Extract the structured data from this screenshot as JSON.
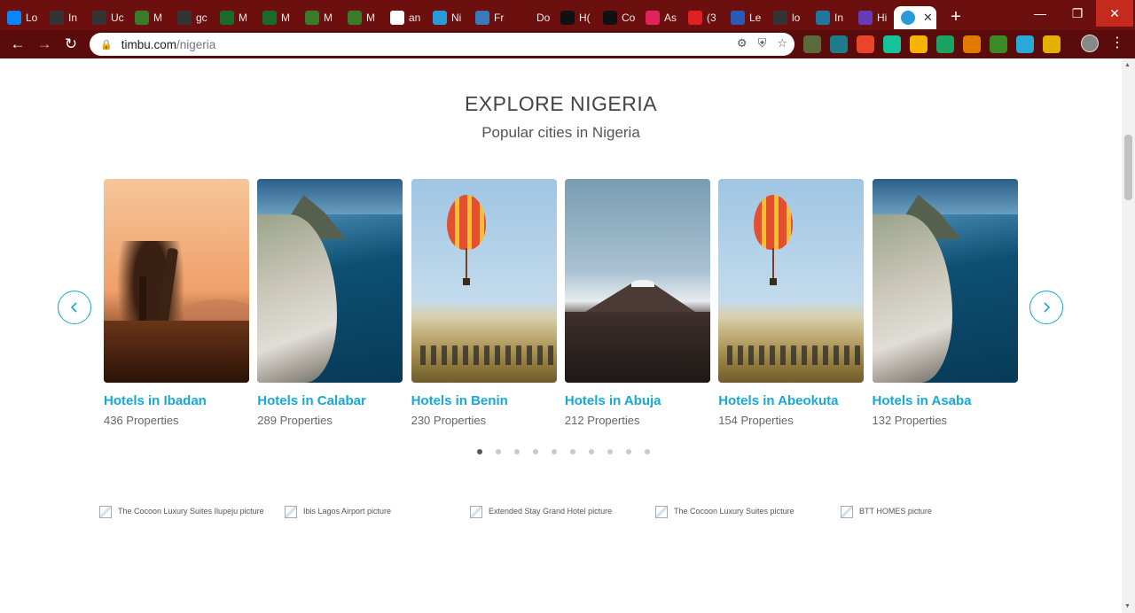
{
  "browser": {
    "tabs": [
      {
        "label": "Lo",
        "icon": "u-icon",
        "color": "#0a84ff"
      },
      {
        "label": "In",
        "icon": "globe-icon",
        "color": "#333333"
      },
      {
        "label": "Uc",
        "icon": "globe-icon",
        "color": "#333333"
      },
      {
        "label": "M",
        "icon": "plant-icon",
        "color": "#3a7a2a"
      },
      {
        "label": "gc",
        "icon": "globe-icon",
        "color": "#333333"
      },
      {
        "label": "M",
        "icon": "n-icon",
        "color": "#1a6a2a"
      },
      {
        "label": "M",
        "icon": "n-icon",
        "color": "#1a6a2a"
      },
      {
        "label": "M",
        "icon": "plant-icon",
        "color": "#3a7a2a"
      },
      {
        "label": "M",
        "icon": "plant-icon",
        "color": "#3a7a2a"
      },
      {
        "label": "an",
        "icon": "google-icon",
        "color": "#ffffff"
      },
      {
        "label": "Ni",
        "icon": "circle-icon",
        "color": "#2a9ad8"
      },
      {
        "label": "Fr",
        "icon": "robot-icon",
        "color": "#3a7ab8"
      },
      {
        "label": "Do",
        "icon": "download-icon",
        "color": "#6b0f0f"
      },
      {
        "label": "H(",
        "icon": "medium-icon",
        "color": "#111111"
      },
      {
        "label": "Co",
        "icon": "medium-icon",
        "color": "#111111"
      },
      {
        "label": "As",
        "icon": "music-icon",
        "color": "#e0245e"
      },
      {
        "label": "(3",
        "icon": "youtube-icon",
        "color": "#e02020"
      },
      {
        "label": "Le",
        "icon": "doc-icon",
        "color": "#2a5ab8"
      },
      {
        "label": "lo",
        "icon": "globe-icon",
        "color": "#333333"
      },
      {
        "label": "In",
        "icon": "wordpress-icon",
        "color": "#21759b"
      },
      {
        "label": "Hi",
        "icon": "form-icon",
        "color": "#673ab7"
      }
    ],
    "active_tab": {
      "icon": "circle-icon",
      "color": "#2a9ad8"
    },
    "url_host": "timbu.com",
    "url_path": "/nigeria",
    "extensions": [
      {
        "icon": "tree-icon",
        "color": "#5a6a3a"
      },
      {
        "icon": "square-icon",
        "color": "#1f7a8c"
      },
      {
        "icon": "grammarly-red-icon",
        "color": "#e8452b"
      },
      {
        "icon": "grammarly-icon",
        "color": "#15c39a"
      },
      {
        "icon": "drive-icon",
        "color": "#f4b400"
      },
      {
        "icon": "edge-icon",
        "color": "#1aa260"
      },
      {
        "icon": "pen-icon",
        "color": "#e07b00"
      },
      {
        "icon": "table-icon",
        "color": "#3a8a2a"
      },
      {
        "icon": "send-icon",
        "color": "#2aa8d8"
      },
      {
        "icon": "fork-icon",
        "color": "#e6b000"
      }
    ]
  },
  "page": {
    "heading": "EXPLORE NIGERIA",
    "subheading": "Popular cities in Nigeria",
    "accent": "#17a8d8",
    "cities": [
      {
        "title": "Hotels in Ibadan",
        "count": "436 Properties",
        "scene": "sunset"
      },
      {
        "title": "Hotels in Calabar",
        "count": "289 Properties",
        "scene": "coast"
      },
      {
        "title": "Hotels in Benin",
        "count": "230 Properties",
        "scene": "balloon"
      },
      {
        "title": "Hotels in Abuja",
        "count": "212 Properties",
        "scene": "volcano"
      },
      {
        "title": "Hotels in Abeokuta",
        "count": "154 Properties",
        "scene": "balloon"
      },
      {
        "title": "Hotels in Asaba",
        "count": "132 Properties",
        "scene": "coast"
      }
    ],
    "carousel_pages": 10,
    "carousel_active_page": 1,
    "hotels": [
      {
        "alt": "The Cocoon Luxury Suites Ilupeju picture"
      },
      {
        "alt": "Ibis Lagos Airport picture"
      },
      {
        "alt": "Extended Stay Grand Hotel picture"
      },
      {
        "alt": "The Cocoon Luxury Suites picture"
      },
      {
        "alt": "BTT HOMES picture"
      }
    ]
  }
}
